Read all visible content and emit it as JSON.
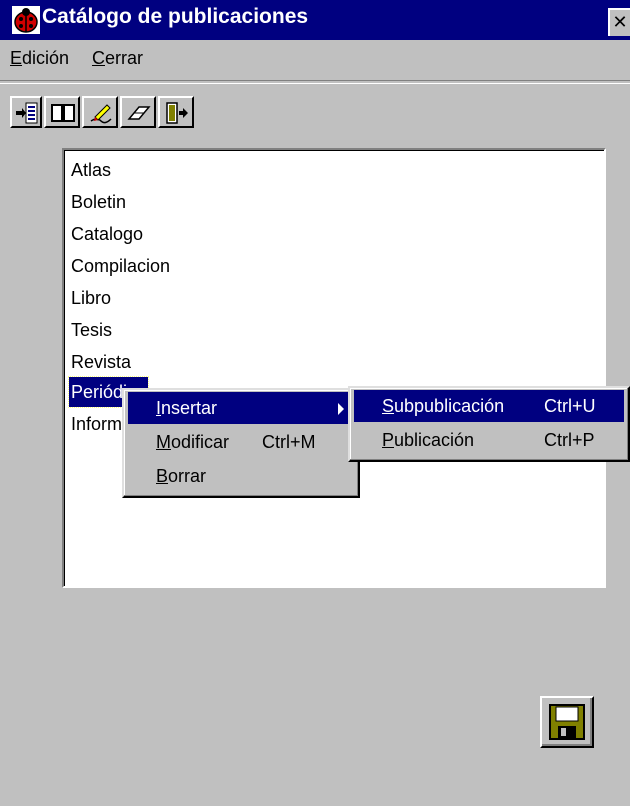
{
  "window": {
    "title": "Catálogo de publicaciones",
    "close_label": "✕"
  },
  "menubar": {
    "edicion": {
      "mnemonic": "E",
      "rest": "dición"
    },
    "cerrar": {
      "mnemonic": "C",
      "rest": "errar"
    }
  },
  "toolbar": {
    "icons": [
      "insert-icon",
      "book-icon",
      "edit-icon",
      "eraser-icon",
      "exit-icon"
    ]
  },
  "list": {
    "items": [
      "Atlas",
      "Boletin",
      "Catalogo",
      "Compilacion",
      "Libro",
      "Tesis",
      "Revista",
      "Periódico",
      "Informe"
    ],
    "selected_index": 7
  },
  "context_menu": {
    "insertar": {
      "mnemonic": "I",
      "rest": "nsertar"
    },
    "modificar": {
      "mnemonic": "M",
      "rest": "odificar",
      "shortcut": "Ctrl+M"
    },
    "borrar": {
      "mnemonic": "B",
      "rest": "orrar"
    }
  },
  "submenu": {
    "subpublicacion": {
      "mnemonic": "S",
      "rest": "ubpublicación",
      "shortcut": "Ctrl+U"
    },
    "publicacion": {
      "mnemonic": "P",
      "rest": "ublicación",
      "shortcut": "Ctrl+P"
    }
  },
  "colors": {
    "face": "#c0c0c0",
    "titlebar": "#000080",
    "highlight": "#000080"
  }
}
